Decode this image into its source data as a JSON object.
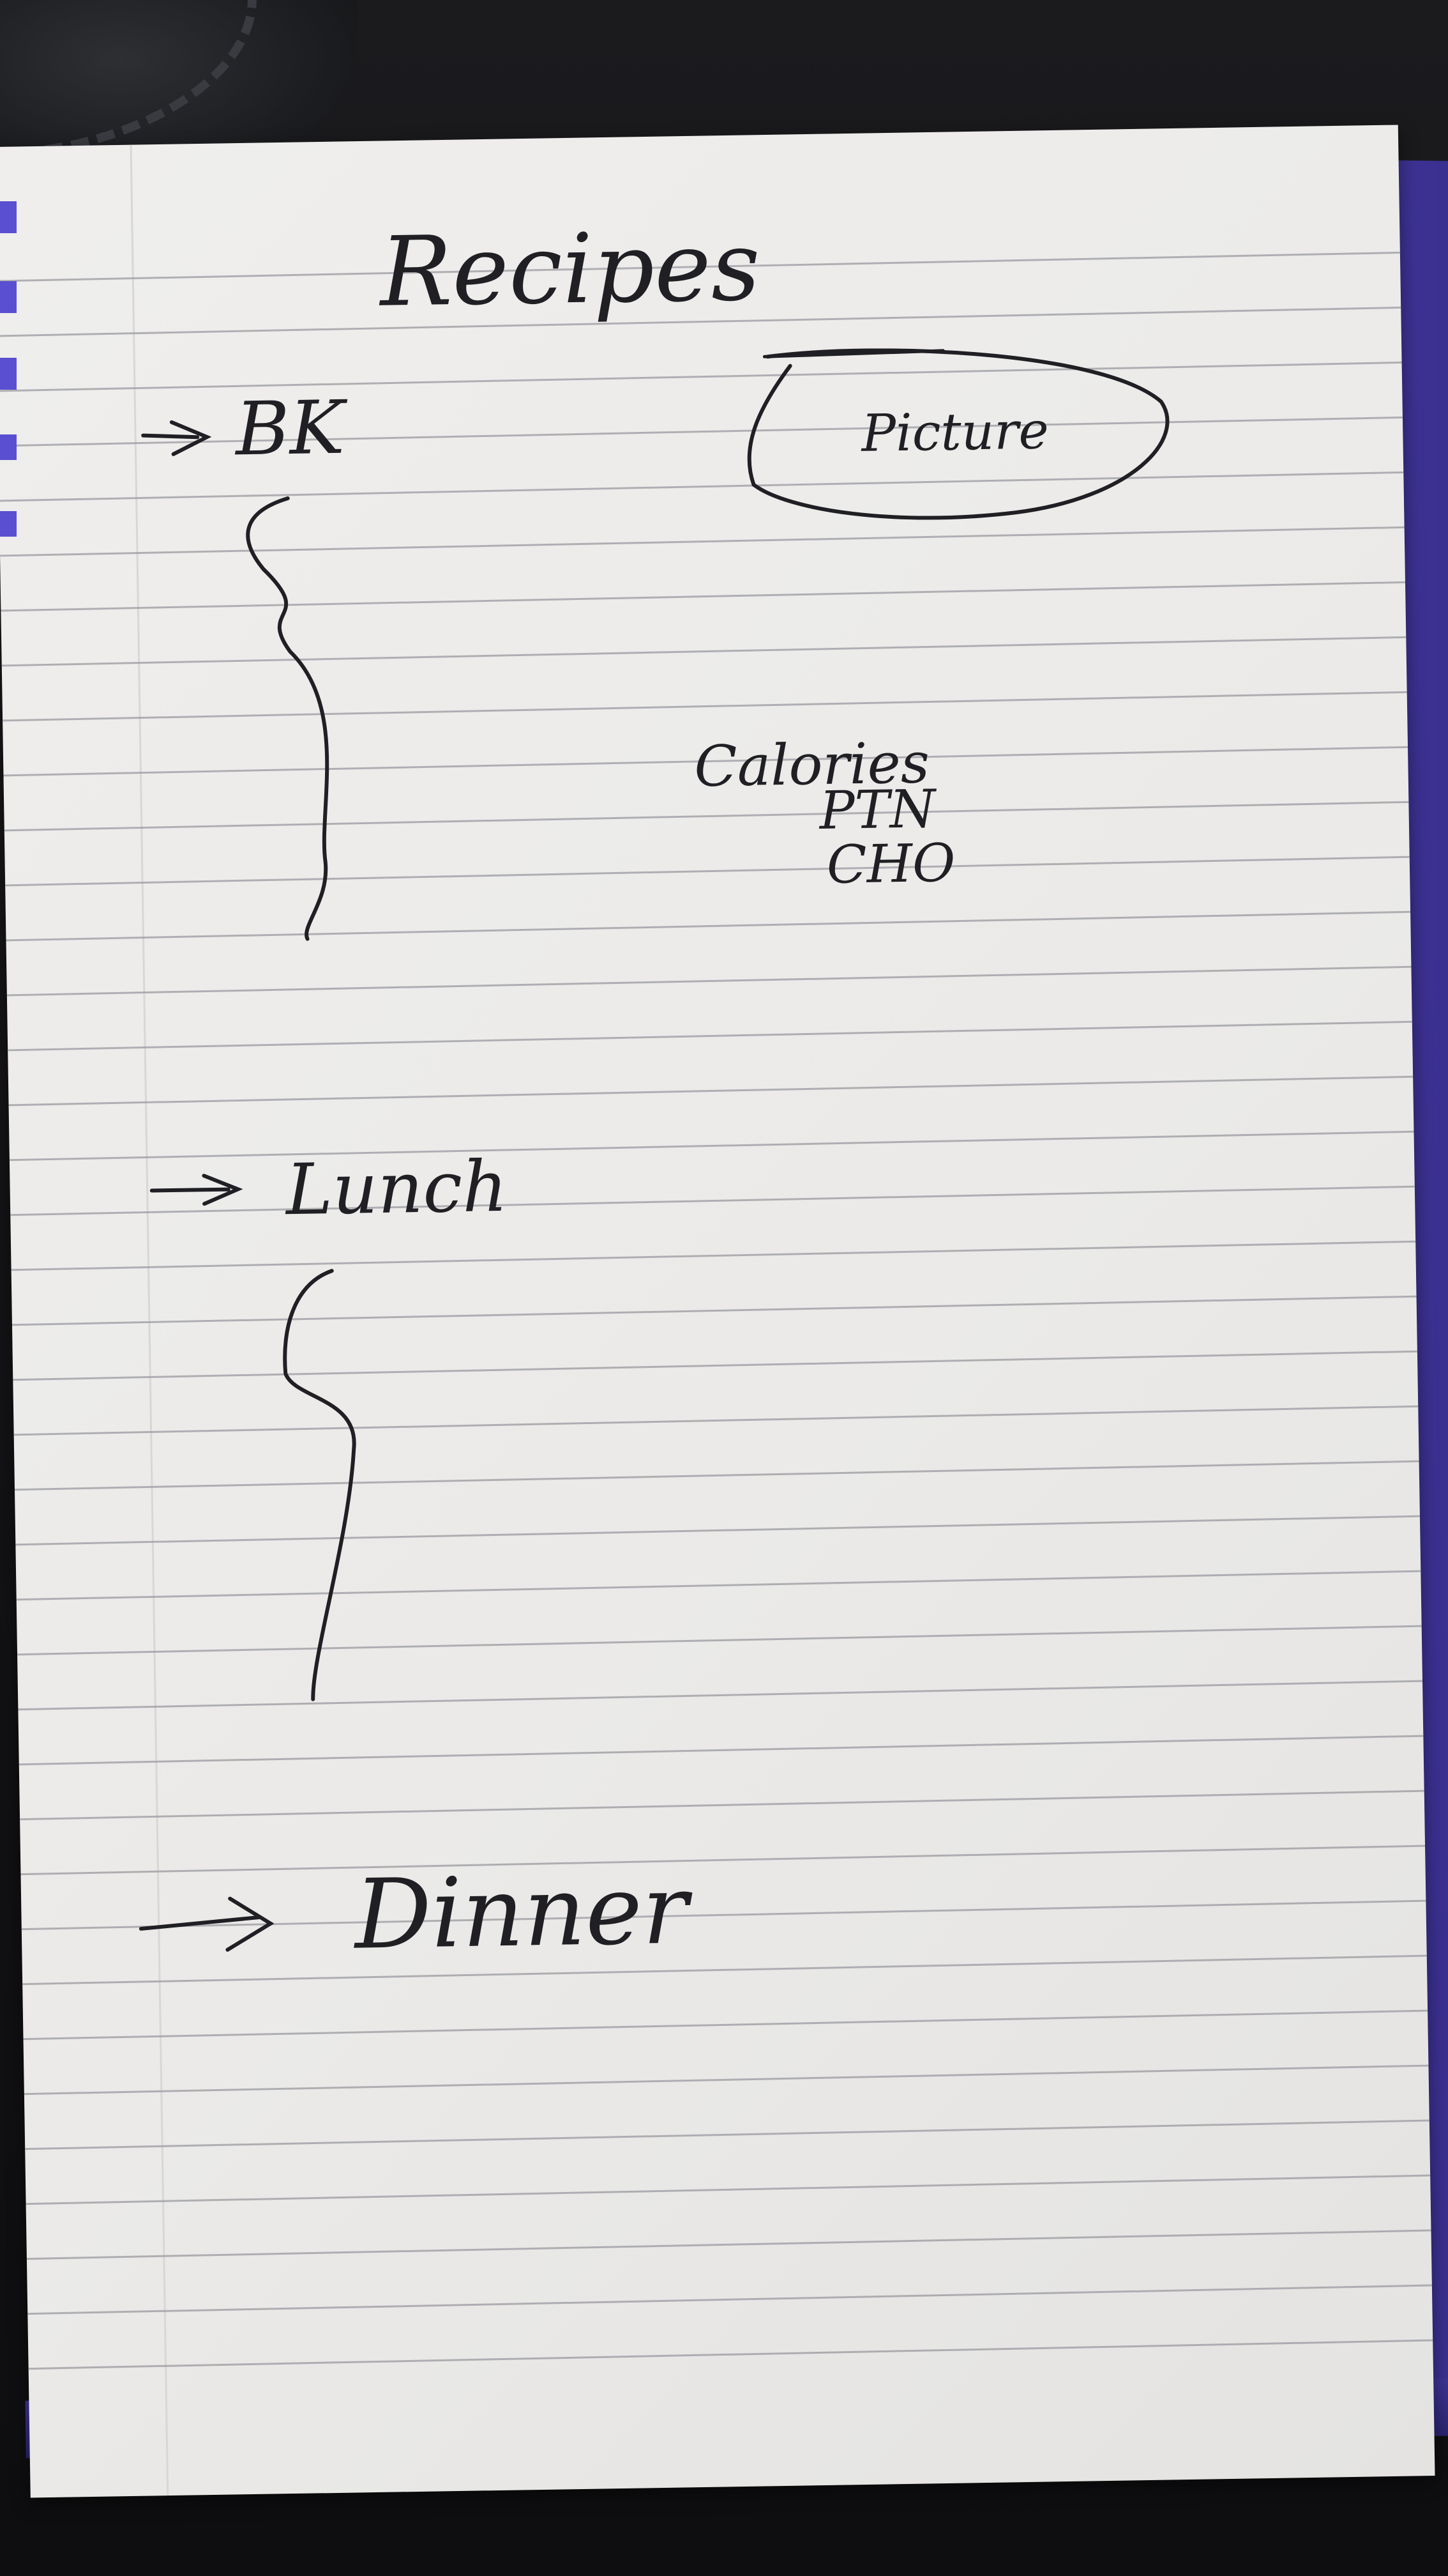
{
  "note": {
    "title": "Recipes",
    "sections": [
      {
        "label": "BK"
      },
      {
        "label": "Lunch"
      },
      {
        "label": "Dinner"
      }
    ],
    "picture_label": "Picture",
    "nutrition": [
      "Calories",
      "PTN",
      "CHO"
    ]
  },
  "colors": {
    "paper": "#eceae8",
    "rule_line": "#9a9aa0",
    "ink": "#1f1f24",
    "notebook": "#4b3fa8",
    "background": "#141416"
  }
}
